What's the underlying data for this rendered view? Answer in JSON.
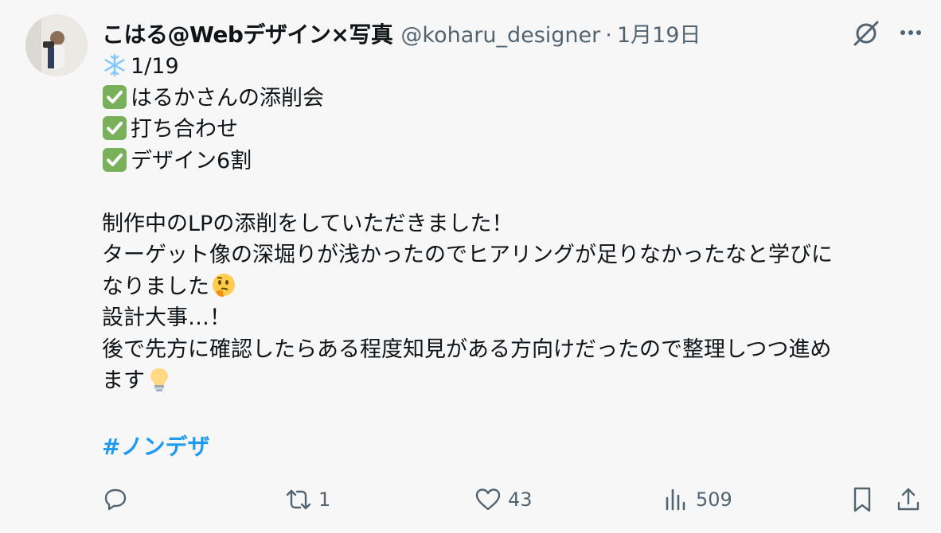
{
  "author": {
    "display_name": "こはる@Webデザイン×写真",
    "handle": "@koharu_designer",
    "separator": "·",
    "date": "1月19日"
  },
  "tweet": {
    "date_line": "1/19",
    "checklist": [
      "はるかさんの添削会",
      "打ち合わせ",
      "デザイン6割"
    ],
    "paragraph": [
      "制作中のLPの添削をしていただきました！",
      "ターゲット像の深堀りが浅かったのでヒアリングが足りなかったなと学びに",
      "なりました",
      "設計大事…！",
      "後で先方に確認したらある程度知見がある方向けだったので整理しつつ進め",
      "ます"
    ],
    "hashtag": "#ノンデザ"
  },
  "actions": {
    "reply_count": "",
    "retweet_count": "1",
    "like_count": "43",
    "view_count": "509"
  },
  "icons": {
    "snowflake": "snowflake-emoji",
    "check": "check-mark-button-emoji",
    "thinking": "thinking-face-emoji",
    "bulb": "light-bulb-emoji",
    "grok": "grok-icon",
    "more": "more-options-icon",
    "reply": "reply-icon",
    "retweet": "retweet-icon",
    "like": "heart-icon",
    "views": "views-chart-icon",
    "bookmark": "bookmark-icon",
    "share": "share-icon"
  },
  "colors": {
    "background": "#f7f7f7",
    "text": "#0f1419",
    "secondary": "#536471",
    "link": "#1d9bf0",
    "check_green": "#78b159"
  }
}
